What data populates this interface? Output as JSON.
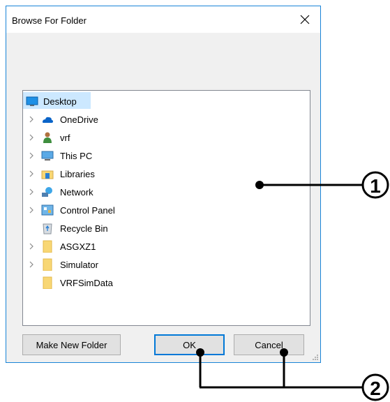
{
  "dialog": {
    "title": "Browse For Folder",
    "close_glyph": "✕"
  },
  "tree": {
    "items": [
      {
        "label": "Desktop",
        "icon": "desktop-icon",
        "expandable": false,
        "selected": true
      },
      {
        "label": "OneDrive",
        "icon": "onedrive-icon",
        "expandable": true
      },
      {
        "label": "vrf",
        "icon": "user-icon",
        "expandable": true
      },
      {
        "label": "This PC",
        "icon": "this-pc-icon",
        "expandable": true
      },
      {
        "label": "Libraries",
        "icon": "libraries-icon",
        "expandable": true
      },
      {
        "label": "Network",
        "icon": "network-icon",
        "expandable": true
      },
      {
        "label": "Control Panel",
        "icon": "control-panel-icon",
        "expandable": true
      },
      {
        "label": "Recycle Bin",
        "icon": "recycle-bin-icon",
        "expandable": false
      },
      {
        "label": "ASGXZ1",
        "icon": "folder-icon",
        "expandable": true
      },
      {
        "label": "Simulator",
        "icon": "folder-icon",
        "expandable": true
      },
      {
        "label": "VRFSimData",
        "icon": "folder-icon",
        "expandable": false
      }
    ]
  },
  "buttons": {
    "make_new_folder": "Make New Folder",
    "ok": "OK",
    "cancel": "Cancel"
  },
  "annotations": {
    "callout_1": "1",
    "callout_2": "2"
  },
  "colors": {
    "accent": "#0078d7",
    "selection": "#cce8ff",
    "folder": "#f8d775"
  }
}
